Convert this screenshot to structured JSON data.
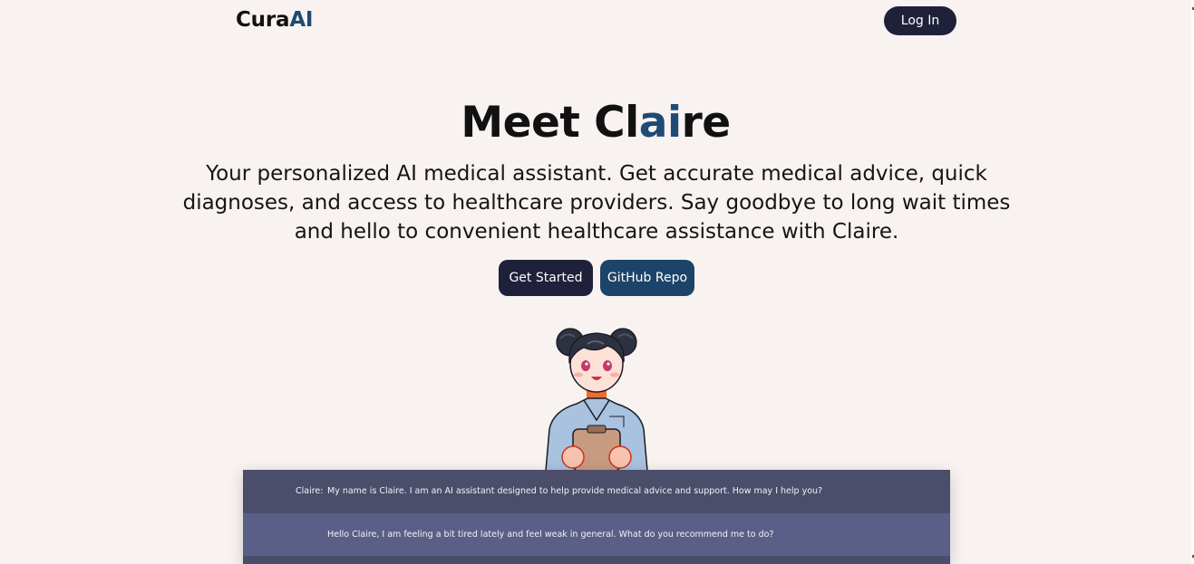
{
  "nav": {
    "logo": {
      "part1": "Cura",
      "part2": "AI"
    },
    "login_label": "Log In"
  },
  "hero": {
    "title_parts": [
      "Meet Cl",
      "ai",
      "re"
    ],
    "subtitle": "Your personalized AI medical assistant. Get accurate medical advice, quick diagnoses, and access to healthcare providers. Say goodbye to long wait times and hello to convenient healthcare assistance with Claire.",
    "buttons": {
      "get_started": "Get Started",
      "github": "GitHub Repo"
    }
  },
  "chat": {
    "messages": [
      {
        "speaker": "Claire:",
        "text": "My name is Claire. I am an AI assistant designed to help provide medical advice and support. How may I help you?"
      },
      {
        "speaker": "",
        "text": "Hello Claire, I am feeling a bit tired lately and feel weak in general. What do you recommend me to do?"
      }
    ]
  },
  "colors": {
    "background": "#f8f2f1",
    "brand_blue": "#1f4a72",
    "dark_button": "#1e2139",
    "chat_assistant_bg": "#4b4e6b",
    "chat_user_bg": "#5b5f87"
  }
}
